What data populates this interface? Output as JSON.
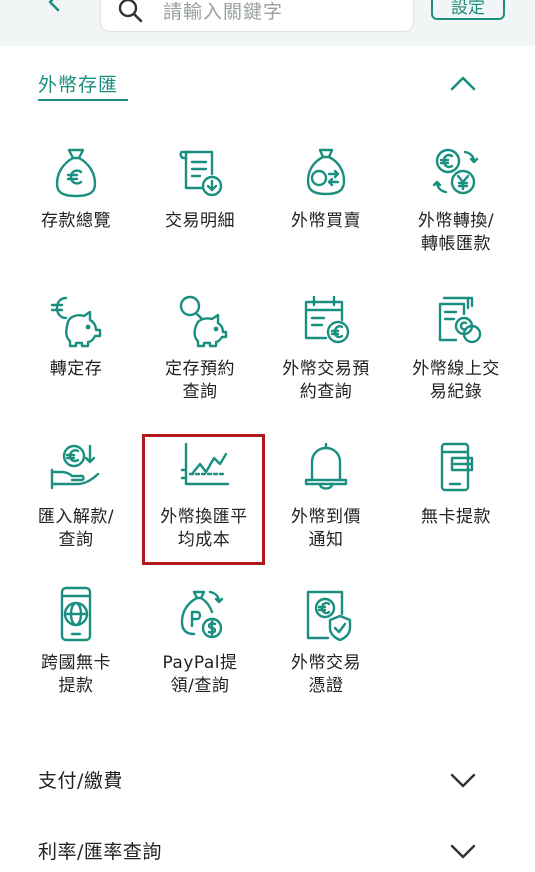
{
  "header": {
    "search_placeholder": "請輸入關鍵字",
    "settings_label": "設定"
  },
  "section": {
    "title": "外幣存匯"
  },
  "items": [
    {
      "label": "存款總覽",
      "icon": "euro-bag-icon"
    },
    {
      "label": "交易明細",
      "icon": "receipt-download-icon"
    },
    {
      "label": "外幣買賣",
      "icon": "currency-exchange-bag-icon"
    },
    {
      "label": "外幣轉換/\n轉帳匯款",
      "icon": "euro-yen-convert-icon"
    },
    {
      "label": "轉定存",
      "icon": "euro-piggy-bank-icon"
    },
    {
      "label": "定存預約\n查詢",
      "icon": "piggy-bank-search-icon"
    },
    {
      "label": "外幣交易預\n約查詢",
      "icon": "calendar-euro-icon"
    },
    {
      "label": "外幣線上交\n易紀錄",
      "icon": "document-coins-icon"
    },
    {
      "label": "匯入解款/\n查詢",
      "icon": "hand-coin-icon"
    },
    {
      "label": "外幣換匯平\n均成本",
      "icon": "line-chart-icon"
    },
    {
      "label": "外幣到價\n通知",
      "icon": "bell-icon"
    },
    {
      "label": "無卡提款",
      "icon": "atm-card-icon"
    },
    {
      "label": "跨國無卡\n提款",
      "icon": "phone-globe-icon"
    },
    {
      "label": "PayPal提\n領/查詢",
      "icon": "paypal-coin-icon"
    },
    {
      "label": "外幣交易\n憑證",
      "icon": "euro-certificate-icon"
    }
  ],
  "collapsed_sections": [
    {
      "title": "支付/繳費"
    },
    {
      "title": "利率/匯率查詢"
    }
  ],
  "colors": {
    "accent": "#1a8f80",
    "highlight": "#b0191c"
  }
}
